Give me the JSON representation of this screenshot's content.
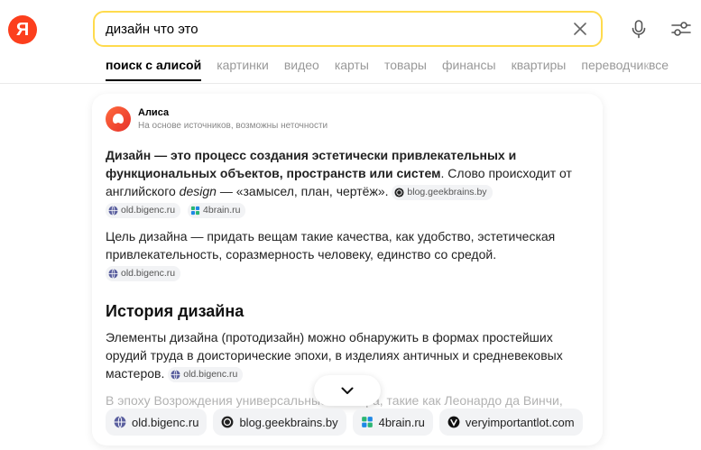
{
  "logo": {
    "letter": "Я"
  },
  "search": {
    "query": "дизайн что это"
  },
  "tabs": [
    {
      "label": "поиск с алисой",
      "active": true
    },
    {
      "label": "картинки"
    },
    {
      "label": "видео"
    },
    {
      "label": "карты"
    },
    {
      "label": "товары"
    },
    {
      "label": "финансы"
    },
    {
      "label": "квартиры"
    },
    {
      "label": "переводчик"
    }
  ],
  "tab_more": "все",
  "answer": {
    "author": "Алиса",
    "note": "На основе источников, возможны неточности",
    "p1_bold": "Дизайн — это процесс создания эстетически привлекательных и функциональных объектов, пространств или систем",
    "p1_rest1": ". Слово происходит от английского ",
    "p1_italic": "design",
    "p1_rest2": " — «замысел, план, чертёж».",
    "p2": "Цель дизайна — придать вещам такие качества, как удобство, эстетическая привлекательность, соразмерность человеку, единство со средой.",
    "h_history": "История дизайна",
    "p3": "Элементы дизайна (протодизайн) можно обнаружить в формах простейших орудий труда в доисторические эпохи, в изделиях античных и средневековых мастеров.",
    "p4_partial": "В эпоху Возрождения универсальные мастера, такие как Леонардо да Винчи,"
  },
  "sources": {
    "bigenc": "old.bigenc.ru",
    "geekbrains": "blog.geekbrains.by",
    "brain4": "4brain.ru",
    "vil": "veryimportantlot.com"
  },
  "colors": {
    "brand": "#fc3f1d",
    "search_border": "#ffdb4d",
    "chip_bg": "#f2f3f5"
  }
}
